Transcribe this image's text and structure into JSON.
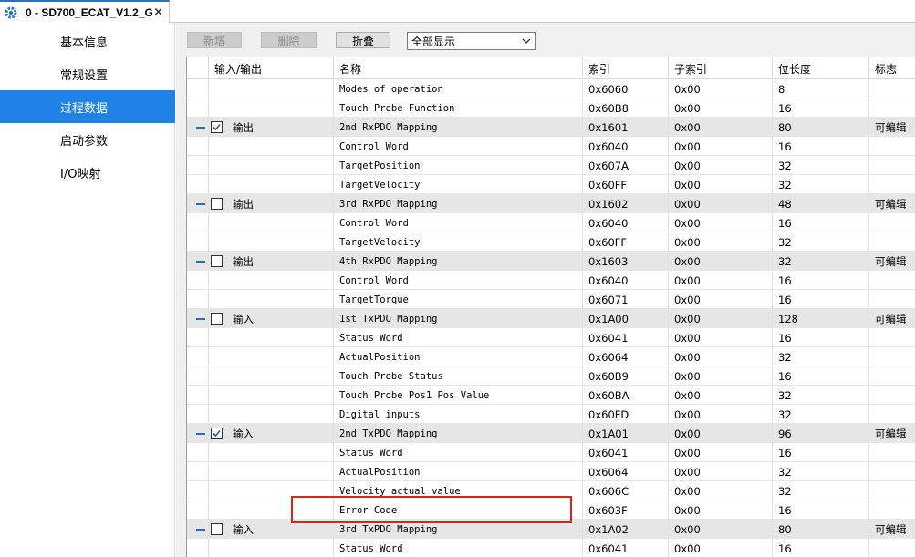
{
  "tab": {
    "title": "0 - SD700_ECAT_V1.2_G",
    "close": "×"
  },
  "sidebar": {
    "items": [
      {
        "label": "基本信息",
        "active": false
      },
      {
        "label": "常规设置",
        "active": false
      },
      {
        "label": "过程数据",
        "active": true
      },
      {
        "label": "启动参数",
        "active": false
      },
      {
        "label": "I/O映射",
        "active": false
      }
    ]
  },
  "toolbar": {
    "add_label": "新增",
    "delete_label": "删除",
    "fold_label": "折叠",
    "filter_value": "全部显示"
  },
  "table": {
    "columns": [
      "输入/输出",
      "名称",
      "索引",
      "子索引",
      "位长度",
      "标志"
    ],
    "rows": [
      {
        "group": false,
        "io": "",
        "name": "Modes of operation",
        "index": "0x6060",
        "sub": "0x00",
        "bits": "8",
        "flag": ""
      },
      {
        "group": false,
        "io": "",
        "name": "Touch Probe Function",
        "index": "0x60B8",
        "sub": "0x00",
        "bits": "16",
        "flag": ""
      },
      {
        "group": true,
        "checked": true,
        "io": "输出",
        "name": "2nd RxPDO Mapping",
        "index": "0x1601",
        "sub": "0x00",
        "bits": "80",
        "flag": "可编辑"
      },
      {
        "group": false,
        "io": "",
        "name": "Control Word",
        "index": "0x6040",
        "sub": "0x00",
        "bits": "16",
        "flag": ""
      },
      {
        "group": false,
        "io": "",
        "name": "TargetPosition",
        "index": "0x607A",
        "sub": "0x00",
        "bits": "32",
        "flag": ""
      },
      {
        "group": false,
        "io": "",
        "name": "TargetVelocity",
        "index": "0x60FF",
        "sub": "0x00",
        "bits": "32",
        "flag": ""
      },
      {
        "group": true,
        "checked": false,
        "io": "输出",
        "name": "3rd RxPDO Mapping",
        "index": "0x1602",
        "sub": "0x00",
        "bits": "48",
        "flag": "可编辑"
      },
      {
        "group": false,
        "io": "",
        "name": "Control Word",
        "index": "0x6040",
        "sub": "0x00",
        "bits": "16",
        "flag": ""
      },
      {
        "group": false,
        "io": "",
        "name": "TargetVelocity",
        "index": "0x60FF",
        "sub": "0x00",
        "bits": "32",
        "flag": ""
      },
      {
        "group": true,
        "checked": false,
        "io": "输出",
        "name": "4th RxPDO Mapping",
        "index": "0x1603",
        "sub": "0x00",
        "bits": "32",
        "flag": "可编辑"
      },
      {
        "group": false,
        "io": "",
        "name": "Control Word",
        "index": "0x6040",
        "sub": "0x00",
        "bits": "16",
        "flag": ""
      },
      {
        "group": false,
        "io": "",
        "name": "TargetTorque",
        "index": "0x6071",
        "sub": "0x00",
        "bits": "16",
        "flag": ""
      },
      {
        "group": true,
        "checked": false,
        "io": "输入",
        "name": "1st TxPDO Mapping",
        "index": "0x1A00",
        "sub": "0x00",
        "bits": "128",
        "flag": "可编辑"
      },
      {
        "group": false,
        "io": "",
        "name": "Status Word",
        "index": "0x6041",
        "sub": "0x00",
        "bits": "16",
        "flag": ""
      },
      {
        "group": false,
        "io": "",
        "name": "ActualPosition",
        "index": "0x6064",
        "sub": "0x00",
        "bits": "32",
        "flag": ""
      },
      {
        "group": false,
        "io": "",
        "name": "Touch Probe Status",
        "index": "0x60B9",
        "sub": "0x00",
        "bits": "16",
        "flag": ""
      },
      {
        "group": false,
        "io": "",
        "name": "Touch Probe Pos1 Pos Value",
        "index": "0x60BA",
        "sub": "0x00",
        "bits": "32",
        "flag": ""
      },
      {
        "group": false,
        "io": "",
        "name": "Digital inputs",
        "index": "0x60FD",
        "sub": "0x00",
        "bits": "32",
        "flag": ""
      },
      {
        "group": true,
        "checked": true,
        "io": "输入",
        "name": "2nd TxPDO Mapping",
        "index": "0x1A01",
        "sub": "0x00",
        "bits": "96",
        "flag": "可编辑"
      },
      {
        "group": false,
        "io": "",
        "name": "Status Word",
        "index": "0x6041",
        "sub": "0x00",
        "bits": "16",
        "flag": ""
      },
      {
        "group": false,
        "io": "",
        "name": "ActualPosition",
        "index": "0x6064",
        "sub": "0x00",
        "bits": "32",
        "flag": ""
      },
      {
        "group": false,
        "io": "",
        "name": "Velocity actual value",
        "index": "0x606C",
        "sub": "0x00",
        "bits": "32",
        "flag": ""
      },
      {
        "group": false,
        "io": "",
        "name": "Error Code",
        "index": "0x603F",
        "sub": "0x00",
        "bits": "16",
        "flag": "",
        "highlighted": true
      },
      {
        "group": true,
        "checked": false,
        "io": "输入",
        "name": "3rd TxPDO Mapping",
        "index": "0x1A02",
        "sub": "0x00",
        "bits": "80",
        "flag": "可编辑"
      },
      {
        "group": false,
        "io": "",
        "name": "Status Word",
        "index": "0x6041",
        "sub": "0x00",
        "bits": "16",
        "flag": ""
      }
    ]
  },
  "colors": {
    "accent": "#1e82e6",
    "highlight_box": "#d9261c",
    "group_row": "#e6e6e6"
  }
}
